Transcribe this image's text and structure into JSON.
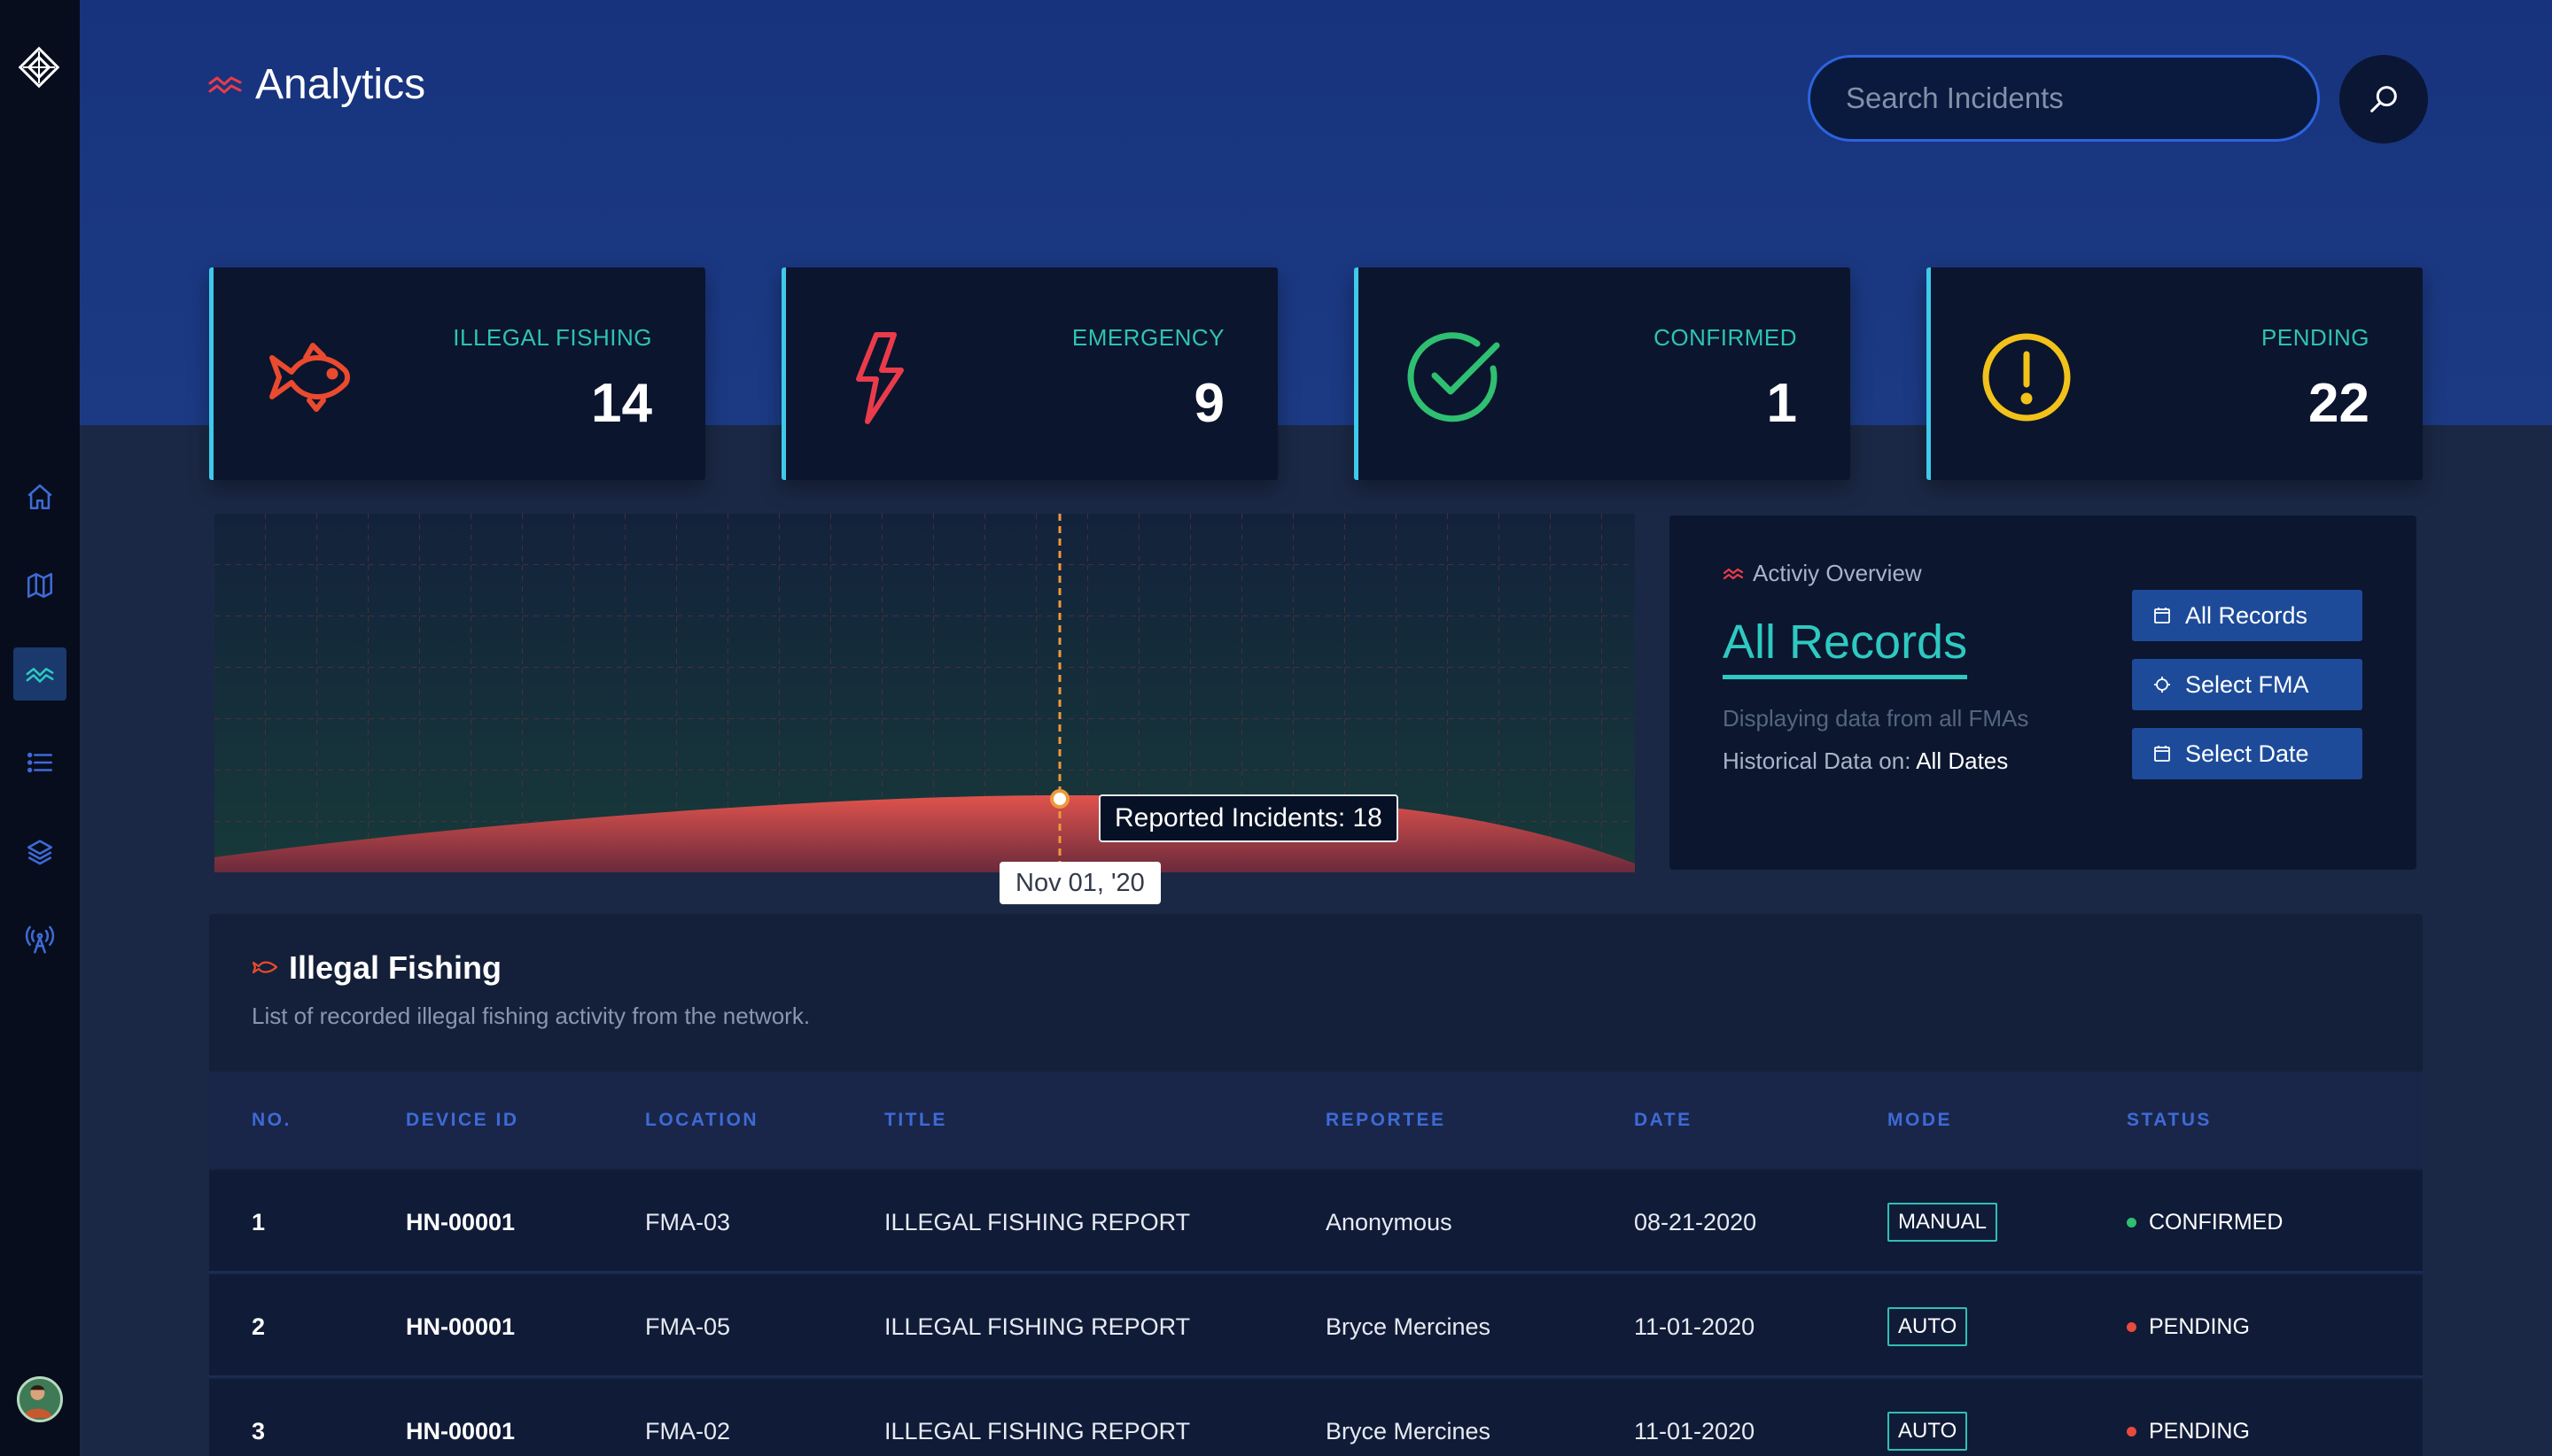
{
  "app": {
    "title": "Analytics",
    "logo": "diamond-grid-logo",
    "colors": {
      "accent": "#2ec9c1",
      "brand": "#17337d",
      "danger": "#ea3b4a",
      "success": "#2fbf71",
      "warning": "#f2c21b"
    }
  },
  "sidebar": {
    "items": [
      {
        "name": "home",
        "icon": "home-icon",
        "active": false
      },
      {
        "name": "map",
        "icon": "map-icon",
        "active": false
      },
      {
        "name": "analytics",
        "icon": "analytics-wave-icon",
        "active": true
      },
      {
        "name": "list",
        "icon": "list-icon",
        "active": false
      },
      {
        "name": "layers",
        "icon": "layers-icon",
        "active": false
      },
      {
        "name": "broadcast",
        "icon": "antenna-icon",
        "active": false
      }
    ],
    "avatar": "user-avatar"
  },
  "search": {
    "placeholder": "Search Incidents",
    "value": "",
    "icon": "search-icon"
  },
  "stats": [
    {
      "label": "ILLEGAL FISHING",
      "value": "14",
      "icon": "fish-icon",
      "color": "#ea4a2e"
    },
    {
      "label": "EMERGENCY",
      "value": "9",
      "icon": "lightning-icon",
      "color": "#ea3b4a"
    },
    {
      "label": "CONFIRMED",
      "value": "1",
      "icon": "check-circle-icon",
      "color": "#2fbf71"
    },
    {
      "label": "PENDING",
      "value": "22",
      "icon": "alert-circle-icon",
      "color": "#f2c21b"
    }
  ],
  "chart_data": {
    "type": "area",
    "series": [
      {
        "name": "Reported Incidents",
        "values": []
      }
    ],
    "highlight": {
      "x": "Nov 01, '20",
      "label": "Reported Incidents: 18",
      "value": 18
    },
    "grid": true
  },
  "overview": {
    "subtitle": "Activiy Overview",
    "title": "All Records",
    "description": "Displaying data from all FMAs",
    "historical_label": "Historical Data on:",
    "historical_value": "All Dates",
    "buttons": [
      {
        "label": "All Records",
        "icon": "calendar-icon"
      },
      {
        "label": "Select FMA",
        "icon": "target-icon"
      },
      {
        "label": "Select Date",
        "icon": "calendar-icon"
      }
    ]
  },
  "table": {
    "title": "Illegal Fishing",
    "subtitle": "List of recorded illegal fishing activity from the network.",
    "icon": "fish-outline-icon",
    "columns": [
      "NO.",
      "DEVICE ID",
      "LOCATION",
      "TITLE",
      "REPORTEE",
      "DATE",
      "MODE",
      "STATUS"
    ],
    "rows": [
      {
        "no": "1",
        "device_id": "HN-00001",
        "location": "FMA-03",
        "title": "ILLEGAL FISHING REPORT",
        "reportee": "Anonymous",
        "date": "08-21-2020",
        "mode": "MANUAL",
        "status": "CONFIRMED",
        "status_color": "#2fbf71"
      },
      {
        "no": "2",
        "device_id": "HN-00001",
        "location": "FMA-05",
        "title": "ILLEGAL FISHING REPORT",
        "reportee": "Bryce Mercines",
        "date": "11-01-2020",
        "mode": "AUTO",
        "status": "PENDING",
        "status_color": "#ea4a3e"
      },
      {
        "no": "3",
        "device_id": "HN-00001",
        "location": "FMA-02",
        "title": "ILLEGAL FISHING REPORT",
        "reportee": "Bryce Mercines",
        "date": "11-01-2020",
        "mode": "AUTO",
        "status": "PENDING",
        "status_color": "#ea4a3e"
      }
    ]
  }
}
